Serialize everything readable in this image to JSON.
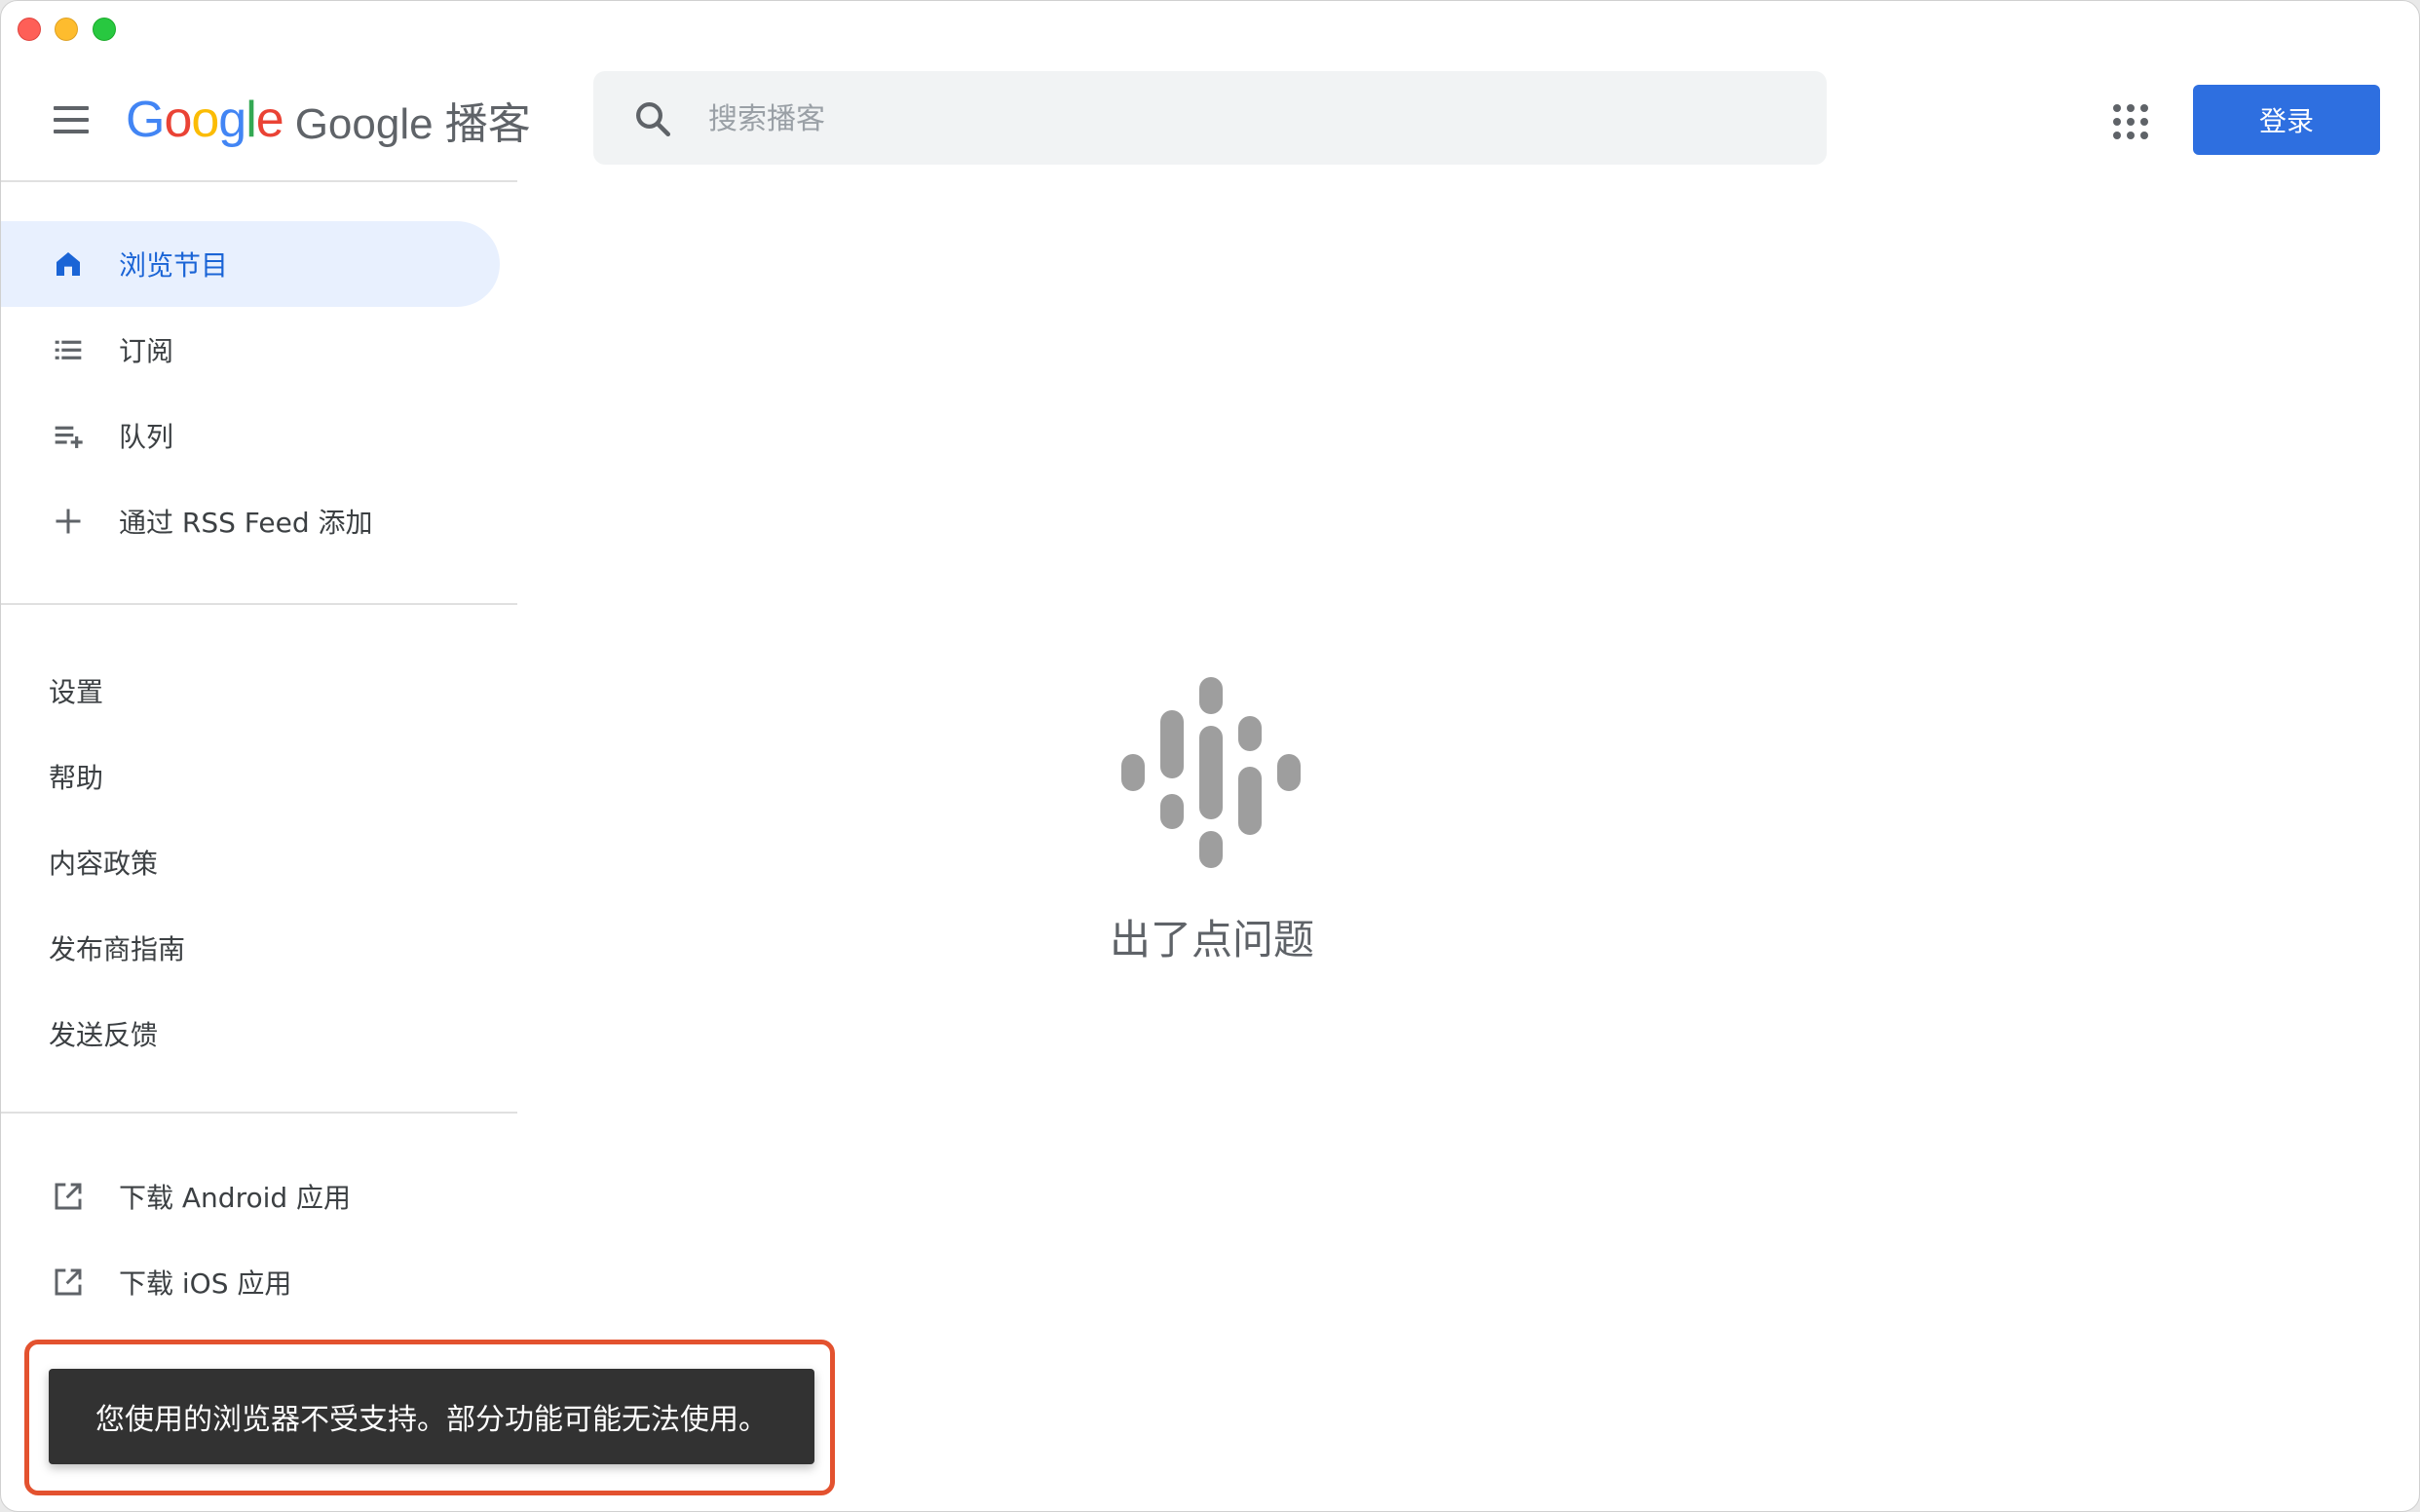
{
  "window": {
    "controls": [
      "close",
      "minimize",
      "maximize"
    ]
  },
  "header": {
    "logo_letters": [
      "G",
      "o",
      "o",
      "g",
      "l",
      "e"
    ],
    "logo_colors": [
      "#4285F4",
      "#EA4335",
      "#FBBC05",
      "#4285F4",
      "#34A853",
      "#EA4335"
    ],
    "app_name": "Google 播客",
    "search_placeholder": "搜索播客",
    "search_value": "",
    "signin_label": "登录",
    "accent_color": "#2e6fe0"
  },
  "sidebar": {
    "nav_items": [
      {
        "label": "浏览节目",
        "icon": "home-icon",
        "active": true
      },
      {
        "label": "订阅",
        "icon": "list-icon",
        "active": false
      },
      {
        "label": "队列",
        "icon": "playlist-add-icon",
        "active": false
      },
      {
        "label": "通过 RSS Feed 添加",
        "icon": "plus-icon",
        "active": false
      }
    ],
    "links": [
      "设置",
      "帮助",
      "内容政策",
      "发布商指南",
      "发送反馈"
    ],
    "downloads": [
      {
        "label": "下载 Android 应用",
        "icon": "open-in-new-icon"
      },
      {
        "label": "下载 iOS 应用",
        "icon": "open-in-new-icon"
      }
    ]
  },
  "main": {
    "error_icon": "google-podcasts-icon",
    "error_message": "出了点问题"
  },
  "toast": {
    "message": "您使用的浏览器不受支持。部分功能可能无法使用。",
    "highlight_color": "#e3522f"
  }
}
